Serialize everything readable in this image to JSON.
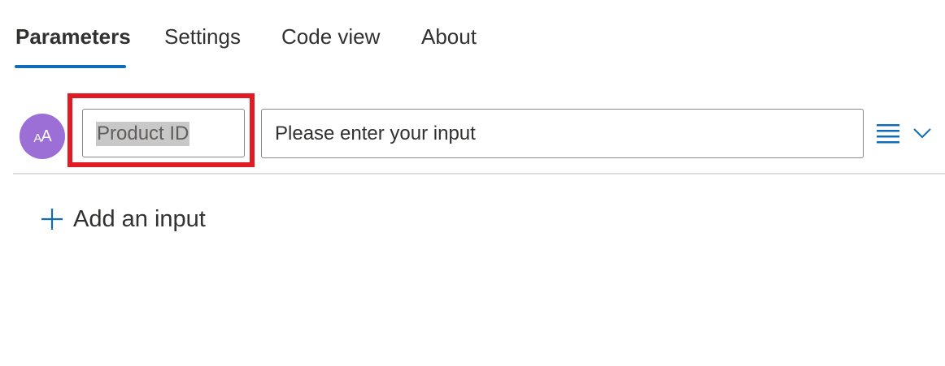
{
  "tabs": [
    {
      "label": "Parameters",
      "active": true
    },
    {
      "label": "Settings",
      "active": false
    },
    {
      "label": "Code view",
      "active": false
    },
    {
      "label": "About",
      "active": false
    }
  ],
  "parameter": {
    "avatar_text_small": "A",
    "avatar_text_large": "A",
    "name_value": "Product ID",
    "value_placeholder": "Please enter your input",
    "type_icon": "list-lines-icon",
    "expand_icon": "chevron-down-icon"
  },
  "add_input": {
    "label": "Add an input",
    "icon": "plus-icon"
  },
  "colors": {
    "accent": "#0f6cbd",
    "avatar": "#9b6fd6",
    "highlight": "#e01b24"
  }
}
